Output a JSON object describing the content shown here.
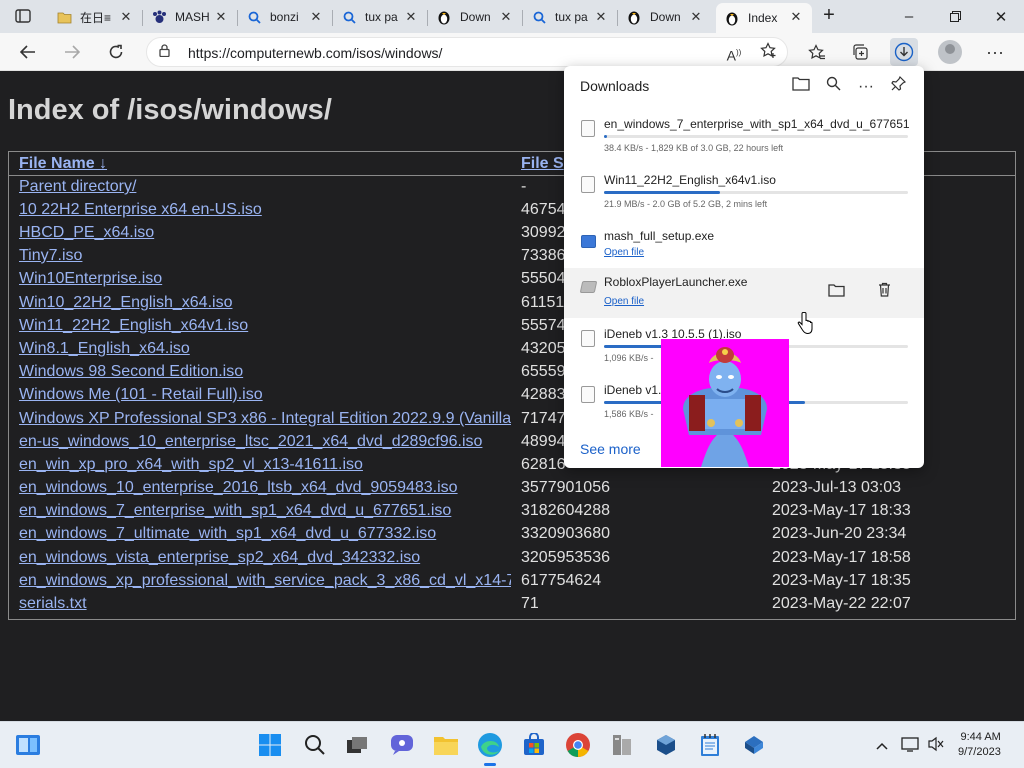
{
  "tabs": [
    {
      "title": "在日≡",
      "icon": "folder-icon"
    },
    {
      "title": "MASH",
      "icon": "paw-icon"
    },
    {
      "title": "bonzi",
      "icon": "search-icon"
    },
    {
      "title": "tux pa",
      "icon": "search-icon"
    },
    {
      "title": "Down",
      "icon": "penguin-icon"
    },
    {
      "title": "tux pa",
      "icon": "search-icon"
    },
    {
      "title": "Down",
      "icon": "penguin-icon"
    },
    {
      "title": "Index",
      "icon": "penguin-icon"
    }
  ],
  "address_bar": {
    "url": "https://computernewb.com/isos/windows/"
  },
  "page": {
    "heading": "Index of /isos/windows/",
    "columns": {
      "name": "File Name  ↓",
      "size": "File S"
    },
    "rows": [
      {
        "name": "Parent directory/",
        "size": "-",
        "date": ""
      },
      {
        "name": "10 22H2 Enterprise x64 en-US.iso",
        "size": "46754",
        "date": ""
      },
      {
        "name": "HBCD_PE_x64.iso",
        "size": "30992",
        "date": ""
      },
      {
        "name": "Tiny7.iso",
        "size": "73386",
        "date": ""
      },
      {
        "name": "Win10Enterprise.iso",
        "size": "55504",
        "date": ""
      },
      {
        "name": "Win10_22H2_English_x64.iso",
        "size": "61151",
        "date": ""
      },
      {
        "name": "Win11_22H2_English_x64v1.iso",
        "size": "55574",
        "date": ""
      },
      {
        "name": "Win8.1_English_x64.iso",
        "size": "43205",
        "date": ""
      },
      {
        "name": "Windows 98 Second Edition.iso",
        "size": "65559",
        "date": ""
      },
      {
        "name": "Windows Me (101 - Retail Full).iso",
        "size": "42883",
        "date": ""
      },
      {
        "name": "Windows XP Professional SP3 x86 - Integral Edition 2022.9.9 (Vanilla",
        "size": "71747",
        "date": ""
      },
      {
        "name": "en-us_windows_10_enterprise_ltsc_2021_x64_dvd_d289cf96.iso",
        "size": "48994",
        "date": ""
      },
      {
        "name": "en_win_xp_pro_x64_with_sp2_vl_x13-41611.iso",
        "size": "62816",
        "date": "2023-May-17 18:38"
      },
      {
        "name": "en_windows_10_enterprise_2016_ltsb_x64_dvd_9059483.iso",
        "size": "3577901056",
        "date": "2023-Jul-13 03:03"
      },
      {
        "name": "en_windows_7_enterprise_with_sp1_x64_dvd_u_677651.iso",
        "size": "3182604288",
        "date": "2023-May-17 18:33"
      },
      {
        "name": "en_windows_7_ultimate_with_sp1_x64_dvd_u_677332.iso",
        "size": "3320903680",
        "date": "2023-Jun-20 23:34"
      },
      {
        "name": "en_windows_vista_enterprise_sp2_x64_dvd_342332.iso",
        "size": "3205953536",
        "date": "2023-May-17 18:58"
      },
      {
        "name": "en_windows_xp_professional_with_service_pack_3_x86_cd_vl_x14-7",
        "size": "617754624",
        "date": "2023-May-17 18:35"
      },
      {
        "name": "serials.txt",
        "size": "71",
        "date": "2023-May-22 22:07"
      }
    ]
  },
  "downloads": {
    "title": "Downloads",
    "see_more": "See more",
    "items": [
      {
        "name": "en_windows_7_enterprise_with_sp1_x64_dvd_u_677651.i...",
        "status": "38.4 KB/s - 1,829 KB of 3.0 GB, 22 hours left",
        "progress": 0.01
      },
      {
        "name": "Win11_22H2_English_x64v1.iso",
        "status": "21.9 MB/s - 2.0 GB of 5.2 GB, 2 mins left",
        "progress": 0.38
      },
      {
        "name": "mash_full_setup.exe",
        "link": "Open file"
      },
      {
        "name": "RobloxPlayerLauncher.exe",
        "link": "Open file"
      },
      {
        "name": "iDeneb v1.3 10.5.5 (1).iso",
        "status": "1,096 KB/s -",
        "progress": 0.2
      },
      {
        "name": "iDeneb v1.",
        "status": "1,586 KB/s -",
        "progress": 0.66
      }
    ]
  },
  "taskbar": {
    "time": "9:44 AM",
    "date": "9/7/2023"
  },
  "colors": {
    "link": "#9ab4f2",
    "page_bg": "#1f1f21",
    "accent": "#2a6cc4",
    "overlay_bg": "#ff00ff"
  }
}
